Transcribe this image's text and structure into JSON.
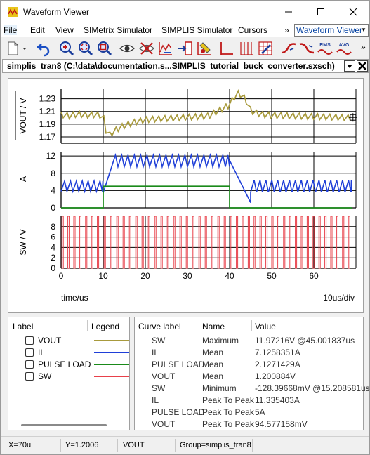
{
  "window": {
    "title": "Waveform Viewer"
  },
  "menu": {
    "items": [
      "File",
      "Edit",
      "View",
      "SIMetrix Simulator",
      "SIMPLIS Simulator",
      "Cursors"
    ],
    "overflow": "»",
    "combo_value": "Waveform Viewer"
  },
  "toolbar": {
    "overflow": "»"
  },
  "tab": {
    "title": "simplis_tran8 (C:\\data\\documentation.s...SIMPLIS_tutorial_buck_converter.sxsch)"
  },
  "chart_data": [
    {
      "type": "line",
      "ylabel": "VOUT / V",
      "yticks": [
        "1.23",
        "1.21",
        "1.19",
        "1.17"
      ],
      "ylim": [
        1.16,
        1.245
      ],
      "series": [
        {
          "name": "VOUT",
          "color": "#a89a3c",
          "x": [
            0,
            2,
            4,
            6,
            8,
            10,
            11,
            12,
            14,
            16,
            18,
            20,
            25,
            30,
            35,
            40,
            41,
            42,
            43,
            44,
            45,
            46,
            48,
            50,
            55,
            60,
            65,
            68.5
          ],
          "y": [
            1.205,
            1.203,
            1.206,
            1.204,
            1.205,
            1.204,
            1.168,
            1.176,
            1.185,
            1.19,
            1.194,
            1.197,
            1.199,
            1.201,
            1.203,
            1.22,
            1.232,
            1.238,
            1.236,
            1.226,
            1.212,
            1.208,
            1.205,
            1.204,
            1.203,
            1.202,
            1.201,
            1.2
          ]
        }
      ]
    },
    {
      "type": "line",
      "ylabel": "A",
      "yticks": [
        "12",
        "8",
        "4",
        "0"
      ],
      "ylim": [
        0,
        13
      ],
      "series": [
        {
          "name": "IL",
          "color": "#1f3fd8",
          "kind": "sawtooth",
          "segments": [
            [
              0,
              10,
              3.8,
              6.2,
              1.4
            ],
            [
              10,
              12,
              3.5,
              9.5,
              0
            ],
            [
              12,
              40,
              9.5,
              12.2,
              1.5
            ],
            [
              40,
              45,
              11.0,
              1.2,
              0
            ],
            [
              45,
              69,
              3.6,
              6.4,
              1.4
            ]
          ]
        },
        {
          "name": "PULSE LOAD",
          "color": "#1a8a1a",
          "x": [
            0,
            10,
            10,
            40,
            40,
            69
          ],
          "y": [
            0,
            0,
            5,
            5,
            0,
            0
          ]
        }
      ]
    },
    {
      "type": "line",
      "ylabel": "SW / V",
      "yticks": [
        "8",
        "6",
        "4",
        "2",
        "0"
      ],
      "ylim": [
        0,
        10
      ],
      "series": [
        {
          "name": "SW",
          "color": "#e8404a",
          "kind": "pulses",
          "high": 10,
          "periods": [
            [
              0,
              10,
              1.4
            ],
            [
              10,
              40,
              1.5
            ],
            [
              40,
              69,
              1.4
            ]
          ],
          "duty": 0.2
        }
      ]
    }
  ],
  "plot": {
    "xticks": [
      "0",
      "10",
      "20",
      "30",
      "40",
      "50",
      "60"
    ],
    "xlim": [
      0,
      70
    ],
    "xlabel": "time/us",
    "div_label": "10us/div"
  },
  "legend": {
    "header_label": "Label",
    "header_legend": "Legend",
    "items": [
      {
        "label": "VOUT",
        "color": "#a89a3c"
      },
      {
        "label": "IL",
        "color": "#1f3fd8"
      },
      {
        "label": "PULSE LOAD",
        "color": "#1a8a1a"
      },
      {
        "label": "SW",
        "color": "#e8404a"
      }
    ]
  },
  "measurements": {
    "headers": [
      "Curve label",
      "Name",
      "Value"
    ],
    "rows": [
      {
        "curve": "SW",
        "name": "Maximum",
        "value": "11.97216V @45.001837us"
      },
      {
        "curve": "IL",
        "name": "Mean",
        "value": "7.1258351A"
      },
      {
        "curve": "PULSE LOAD",
        "name": "Mean",
        "value": "2.1271429A"
      },
      {
        "curve": "VOUT",
        "name": "Mean",
        "value": "1.200884V"
      },
      {
        "curve": "SW",
        "name": "Minimum",
        "value": "-128.39668mV @15.208581us"
      },
      {
        "curve": "IL",
        "name": "Peak To Peak",
        "value": "11.335403A"
      },
      {
        "curve": "PULSE LOAD",
        "name": "Peak To Peak",
        "value": "5A"
      },
      {
        "curve": "VOUT",
        "name": "Peak To Peak",
        "value": "94.577158mV"
      }
    ]
  },
  "status": {
    "x": "X=70u",
    "y": "Y=1.2006",
    "curve": "VOUT",
    "group": "Group=simplis_tran8"
  }
}
